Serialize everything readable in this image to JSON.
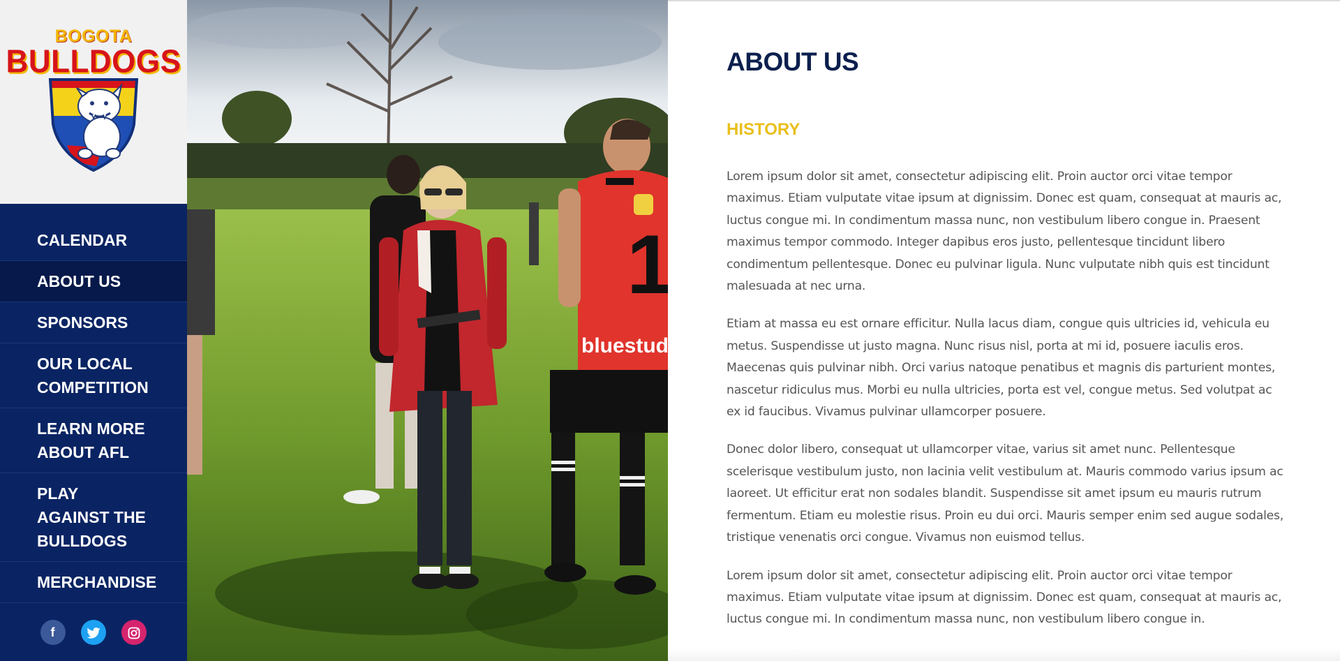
{
  "brand": {
    "logo_line1": "BOGOTA",
    "logo_line2": "BULLDOGS",
    "primary_color": "#0a2463",
    "accent_color": "#e9bf1c",
    "logo_red": "#d7141a"
  },
  "sidebar": {
    "nav": [
      {
        "label": "CALENDAR",
        "active": false
      },
      {
        "label": "ABOUT US",
        "active": true
      },
      {
        "label": "SPONSORS",
        "active": false
      },
      {
        "label": "OUR LOCAL COMPETITION",
        "active": false
      },
      {
        "label": "LEARN MORE ABOUT AFL",
        "active": false
      },
      {
        "label": "PLAY AGAINST THE BULLDOGS",
        "active": false
      },
      {
        "label": "MERCHANDISE",
        "active": false
      }
    ],
    "social": [
      {
        "icon": "facebook-icon",
        "glyph": "f",
        "color": "#3b5998"
      },
      {
        "icon": "twitter-icon",
        "glyph": "",
        "color": "#1da1f2"
      },
      {
        "icon": "instagram-icon",
        "glyph": "",
        "color": "#d6246e"
      }
    ]
  },
  "photo": {
    "jersey_number": "1",
    "jersey_sponsor": "bluestudio"
  },
  "main": {
    "title": "ABOUT US",
    "section_title": "HISTORY",
    "paragraphs": [
      "Lorem ipsum dolor sit amet, consectetur adipiscing elit. Proin auctor orci vitae tempor maximus. Etiam vulputate vitae ipsum at dignissim. Donec est quam, consequat at mauris ac, luctus congue mi. In condimentum massa nunc, non vestibulum libero congue in. Praesent maximus tempor commodo. Integer dapibus eros justo, pellentesque tincidunt libero condimentum pellentesque. Donec eu pulvinar ligula. Nunc vulputate nibh quis est tincidunt malesuada at nec urna.",
      "Etiam at massa eu est ornare efficitur. Nulla lacus diam, congue quis ultricies id, vehicula eu metus. Suspendisse ut justo magna. Nunc risus nisl, porta at mi id, posuere iaculis eros. Maecenas quis pulvinar nibh. Orci varius natoque penatibus et magnis dis parturient montes, nascetur ridiculus mus. Morbi eu nulla ultricies, porta est vel, congue metus. Sed volutpat ac ex id faucibus. Vivamus pulvinar ullamcorper posuere.",
      "Donec dolor libero, consequat ut ullamcorper vitae, varius sit amet nunc. Pellentesque scelerisque vestibulum justo, non lacinia velit vestibulum at. Mauris commodo varius ipsum ac laoreet. Ut efficitur erat non sodales blandit. Suspendisse sit amet ipsum eu mauris rutrum fermentum. Etiam eu molestie risus. Proin eu dui orci. Mauris semper enim sed augue sodales, tristique venenatis orci congue. Vivamus non euismod tellus.",
      "Lorem ipsum dolor sit amet, consectetur adipiscing elit. Proin auctor orci vitae tempor maximus. Etiam vulputate vitae ipsum at dignissim. Donec est quam, consequat at mauris ac, luctus congue mi. In condimentum massa nunc, non vestibulum libero congue in."
    ]
  }
}
